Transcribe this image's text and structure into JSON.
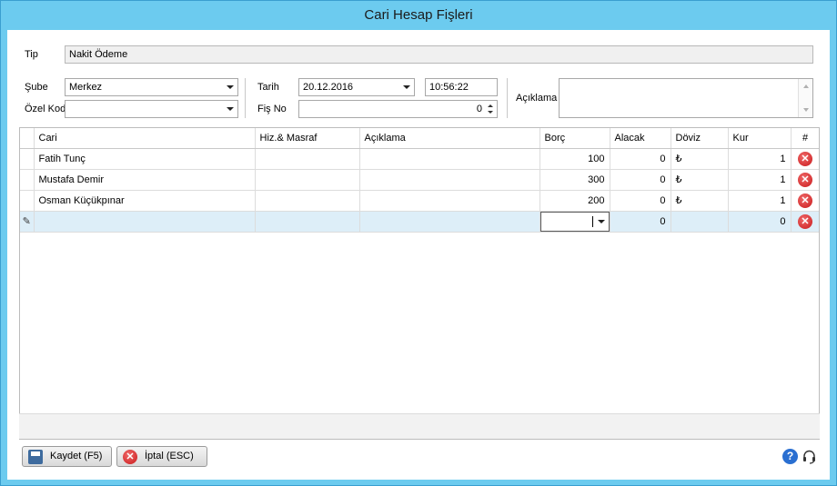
{
  "window": {
    "title": "Cari Hesap Fişleri"
  },
  "form": {
    "tip": {
      "label": "Tip",
      "value": "Nakit Ödeme"
    },
    "sube": {
      "label": "Şube",
      "value": "Merkez"
    },
    "ozel_kod": {
      "label": "Özel Kod",
      "value": ""
    },
    "tarih": {
      "label": "Tarih",
      "date": "20.12.2016",
      "time": "10:56:22"
    },
    "fis_no": {
      "label": "Fiş No",
      "value": "0"
    },
    "aciklama": {
      "label": "Açıklama",
      "value": ""
    }
  },
  "grid": {
    "columns": [
      "Cari",
      "Hiz.& Masraf",
      "Açıklama",
      "Borç",
      "Alacak",
      "Döviz",
      "Kur",
      "#"
    ],
    "rows": [
      {
        "cari": "Fatih Tunç",
        "hiz": "",
        "aciklama": "",
        "borc": "100",
        "alacak": "0",
        "doviz": "₺",
        "kur": "1"
      },
      {
        "cari": "Mustafa Demir",
        "hiz": "",
        "aciklama": "",
        "borc": "300",
        "alacak": "0",
        "doviz": "₺",
        "kur": "1"
      },
      {
        "cari": "Osman Küçükpınar",
        "hiz": "",
        "aciklama": "",
        "borc": "200",
        "alacak": "0",
        "doviz": "₺",
        "kur": "1"
      }
    ],
    "new_row": {
      "alacak": "0",
      "kur": "0"
    },
    "delete_glyph": "✕"
  },
  "buttons": {
    "save": "Kaydet (F5)",
    "cancel": "İptal (ESC)"
  },
  "icons": {
    "help": "?",
    "pencil": "✎"
  },
  "colors": {
    "frame": "#6ccbef",
    "new_row": "#ddeef8",
    "delete": "#c9191b"
  }
}
